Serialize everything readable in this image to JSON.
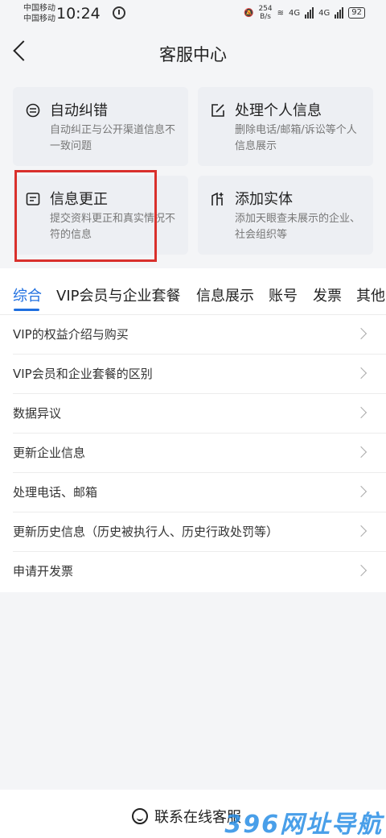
{
  "status_bar": {
    "carrier1": "中国移动",
    "carrier2": "中国移动",
    "time": "10:24",
    "net_speed_value": "254",
    "net_speed_unit": "B/s",
    "signal1": "4G",
    "signal2": "4G",
    "battery": "92"
  },
  "nav": {
    "title": "客服中心"
  },
  "cards": [
    {
      "title": "自动纠错",
      "desc": "自动纠正与公开渠道信息不一致问题",
      "icon": "auto-correct-icon"
    },
    {
      "title": "处理个人信息",
      "desc": "删除电话/邮箱/诉讼等个人信息展示",
      "icon": "edit-icon"
    },
    {
      "title": "信息更正",
      "desc": "提交资料更正和真实情况不符的信息",
      "icon": "document-edit-icon"
    },
    {
      "title": "添加实体",
      "desc": "添加天眼查未展示的企业、社会组织等",
      "icon": "building-add-icon"
    }
  ],
  "tabs": [
    "综合",
    "VIP会员与企业套餐",
    "信息展示",
    "账号",
    "发票",
    "其他"
  ],
  "active_tab": "综合",
  "list_items": [
    "VIP的权益介绍与购买",
    "VIP会员和企业套餐的区别",
    "数据异议",
    "更新企业信息",
    "处理电话、邮箱",
    "更新历史信息（历史被执行人、历史行政处罚等）",
    "申请开发票"
  ],
  "bottom": {
    "contact_label": "联系在线客服"
  },
  "watermark": "396网址导航",
  "colors": {
    "accent": "#1f6fe0",
    "highlight_border": "#d9302c",
    "background": "#f4f5f7"
  }
}
